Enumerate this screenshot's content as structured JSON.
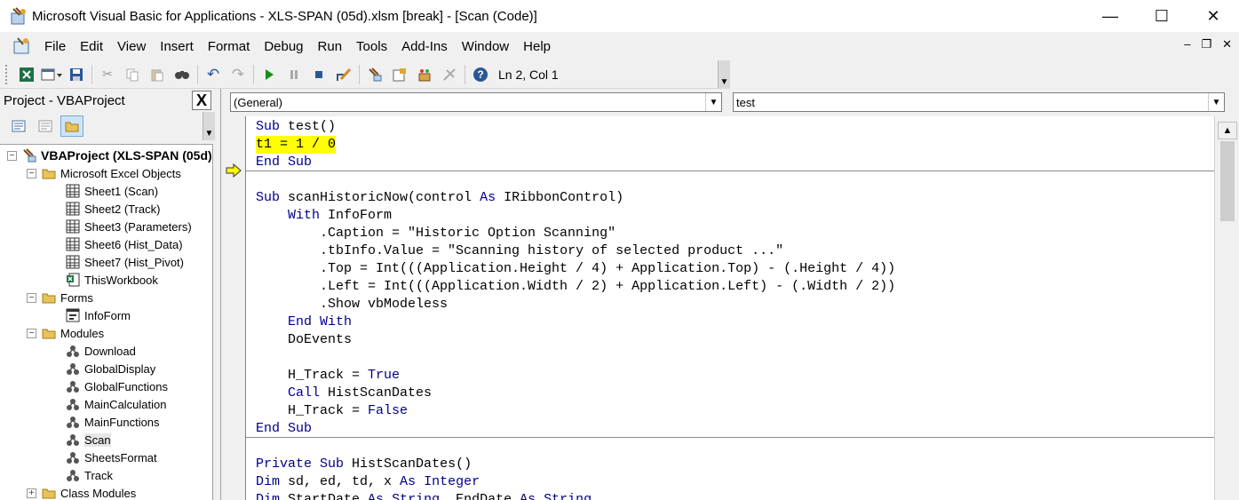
{
  "window": {
    "title": "Microsoft Visual Basic for Applications - XLS-SPAN (05d).xlsm [break] - [Scan (Code)]",
    "minimize": "—",
    "maximize": "☐",
    "close": "✕"
  },
  "menu": {
    "items": [
      "File",
      "Edit",
      "View",
      "Insert",
      "Format",
      "Debug",
      "Run",
      "Tools",
      "Add-Ins",
      "Window",
      "Help"
    ],
    "mdi_minimize": "–",
    "mdi_restore": "❐",
    "mdi_close": "✕"
  },
  "toolbar": {
    "cursor_position": "Ln 2, Col 1"
  },
  "project": {
    "title": "Project - VBAProject",
    "close": "X",
    "tree": [
      {
        "label": "VBAProject (XLS-SPAN (05d)",
        "expander": "−"
      },
      {
        "label": "Microsoft Excel Objects",
        "expander": "−"
      },
      {
        "label": "Sheet1 (Scan)"
      },
      {
        "label": "Sheet2 (Track)"
      },
      {
        "label": "Sheet3 (Parameters)"
      },
      {
        "label": "Sheet6 (Hist_Data)"
      },
      {
        "label": "Sheet7 (Hist_Pivot)"
      },
      {
        "label": "ThisWorkbook"
      },
      {
        "label": "Forms",
        "expander": "−"
      },
      {
        "label": "InfoForm"
      },
      {
        "label": "Modules",
        "expander": "−"
      },
      {
        "label": "Download"
      },
      {
        "label": "GlobalDisplay"
      },
      {
        "label": "GlobalFunctions"
      },
      {
        "label": "MainCalculation"
      },
      {
        "label": "MainFunctions"
      },
      {
        "label": "Scan"
      },
      {
        "label": "SheetsFormat"
      },
      {
        "label": "Track"
      },
      {
        "label": "Class Modules",
        "expander": "+"
      }
    ]
  },
  "code": {
    "object_combo": "(General)",
    "procedure_combo": "test",
    "lines": [
      "Sub test()",
      "t1 = 1 / 0",
      "End Sub",
      "",
      "Sub scanHistoricNow(control As IRibbonControl)",
      "    With InfoForm",
      "        .Caption = \"Historic Option Scanning\"",
      "        .tbInfo.Value = \"Scanning history of selected product ...\"",
      "        .Top = Int(((Application.Height / 4) + Application.Top) - (.Height / 4))",
      "        .Left = Int(((Application.Width / 2) + Application.Left) - (.Width / 2))",
      "        .Show vbModeless",
      "    End With",
      "    DoEvents",
      "",
      "    H_Track = True",
      "    Call HistScanDates",
      "    H_Track = False",
      "End Sub",
      "",
      "Private Sub HistScanDates()",
      "Dim sd, ed, td, x As Integer",
      "Dim StartDate As String, EndDate As String"
    ]
  }
}
